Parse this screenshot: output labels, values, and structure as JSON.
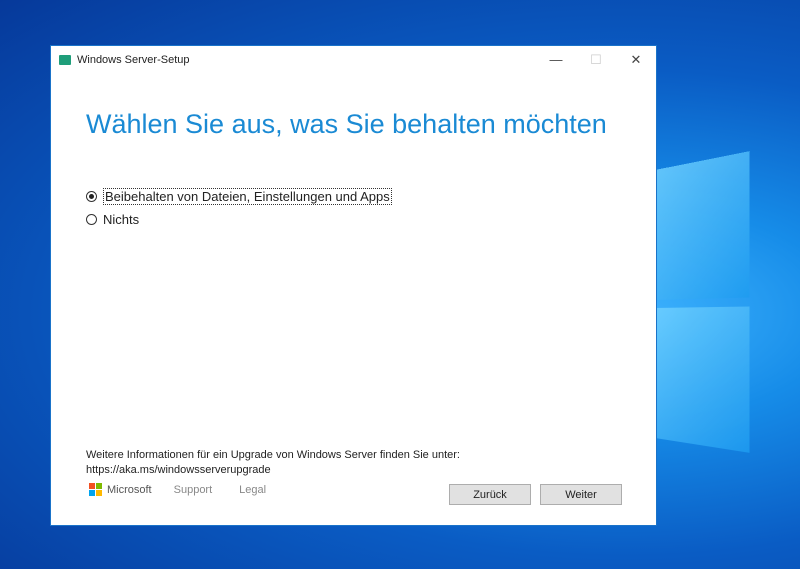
{
  "window": {
    "title": "Windows Server-Setup",
    "minimize": "—",
    "maximize": "☐",
    "close": "✕"
  },
  "heading": "Wählen Sie aus, was Sie behalten möchten",
  "options": [
    {
      "label": "Beibehalten von Dateien, Einstellungen und Apps",
      "selected": true
    },
    {
      "label": "Nichts",
      "selected": false
    }
  ],
  "info": {
    "line1": "Weitere Informationen für ein Upgrade von Windows Server finden Sie unter:",
    "line2": "https://aka.ms/windowsserverupgrade"
  },
  "footer": {
    "brand": "Microsoft",
    "support": "Support",
    "legal": "Legal"
  },
  "buttons": {
    "back": "Zurück",
    "next": "Weiter"
  },
  "colors": {
    "accent": "#1a8ad4"
  }
}
